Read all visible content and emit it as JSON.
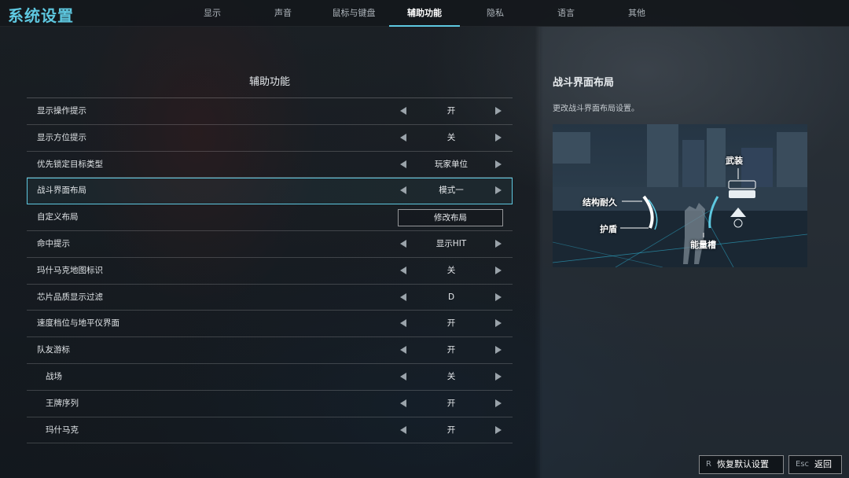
{
  "app": {
    "title": "系统设置"
  },
  "tabs": [
    {
      "label": "显示",
      "active": false
    },
    {
      "label": "声音",
      "active": false
    },
    {
      "label": "鼠标与键盘",
      "active": false
    },
    {
      "label": "辅助功能",
      "active": true
    },
    {
      "label": "隐私",
      "active": false
    },
    {
      "label": "语言",
      "active": false
    },
    {
      "label": "其他",
      "active": false
    }
  ],
  "panel": {
    "heading": "辅助功能"
  },
  "settings": [
    {
      "label": "显示操作提示",
      "value": "开",
      "kind": "selector",
      "sub": false,
      "selected": false
    },
    {
      "label": "显示方位提示",
      "value": "关",
      "kind": "selector",
      "sub": false,
      "selected": false
    },
    {
      "label": "优先锁定目标类型",
      "value": "玩家单位",
      "kind": "selector",
      "sub": false,
      "selected": false
    },
    {
      "label": "战斗界面布局",
      "value": "模式一",
      "kind": "selector",
      "sub": false,
      "selected": true
    },
    {
      "label": "自定义布局",
      "value": "修改布局",
      "kind": "button",
      "sub": false,
      "selected": false
    },
    {
      "label": "命中提示",
      "value": "显示HIT",
      "kind": "selector",
      "sub": false,
      "selected": false
    },
    {
      "label": "玛什马克地图标识",
      "value": "关",
      "kind": "selector",
      "sub": false,
      "selected": false
    },
    {
      "label": "芯片品质显示过滤",
      "value": "D",
      "kind": "selector",
      "sub": false,
      "selected": false
    },
    {
      "label": "速度档位与地平仪界面",
      "value": "开",
      "kind": "selector",
      "sub": false,
      "selected": false
    },
    {
      "label": "队友游标",
      "value": "开",
      "kind": "selector",
      "sub": false,
      "selected": false
    },
    {
      "label": "战场",
      "value": "关",
      "kind": "selector",
      "sub": true,
      "selected": false
    },
    {
      "label": "王牌序列",
      "value": "开",
      "kind": "selector",
      "sub": true,
      "selected": false
    },
    {
      "label": "玛什马克",
      "value": "开",
      "kind": "selector",
      "sub": true,
      "selected": false
    }
  ],
  "description": {
    "title": "战斗界面布局",
    "text": "更改战斗界面布局设置。",
    "preview_callouts": {
      "armament": "武装",
      "durability": "结构耐久",
      "shield": "护盾",
      "energy": "能量槽"
    }
  },
  "footer": {
    "reset_key": "R",
    "reset_label": "恢复默认设置",
    "back_key": "Esc",
    "back_label": "返回"
  },
  "colors": {
    "accent": "#5ec8e0",
    "topbar": "#12161a",
    "text": "#dfe3e6"
  },
  "icons": {
    "left_arrow": "caret-left-icon",
    "right_arrow": "caret-right-icon"
  }
}
